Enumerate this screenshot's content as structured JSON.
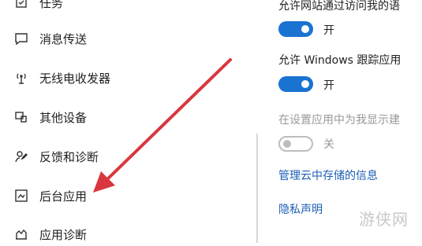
{
  "sidebar": {
    "items": [
      {
        "label": "任务",
        "icon": "task-icon"
      },
      {
        "label": "消息传送",
        "icon": "message-icon"
      },
      {
        "label": "无线电收发器",
        "icon": "radio-antenna-icon"
      },
      {
        "label": "其他设备",
        "icon": "devices-icon"
      },
      {
        "label": "反馈和诊断",
        "icon": "feedback-icon"
      },
      {
        "label": "后台应用",
        "icon": "background-apps-icon"
      },
      {
        "label": "应用诊断",
        "icon": "app-diagnostics-icon"
      }
    ]
  },
  "settings": [
    {
      "label": "允许网站通过访问我的语",
      "state": "开",
      "on": true,
      "disabled": false
    },
    {
      "label": "允许 Windows 跟踪应用",
      "state": "开",
      "on": true,
      "disabled": false
    },
    {
      "label": "在设置应用中为我显示建",
      "state": "关",
      "on": false,
      "disabled": true
    }
  ],
  "links": {
    "cloud_info": "管理云中存储的信息",
    "privacy_statement": "隐私声明"
  },
  "watermark": "游侠网",
  "colors": {
    "accent": "#1a73d1",
    "link": "#1a5fb4",
    "arrow": "#d9363e"
  }
}
